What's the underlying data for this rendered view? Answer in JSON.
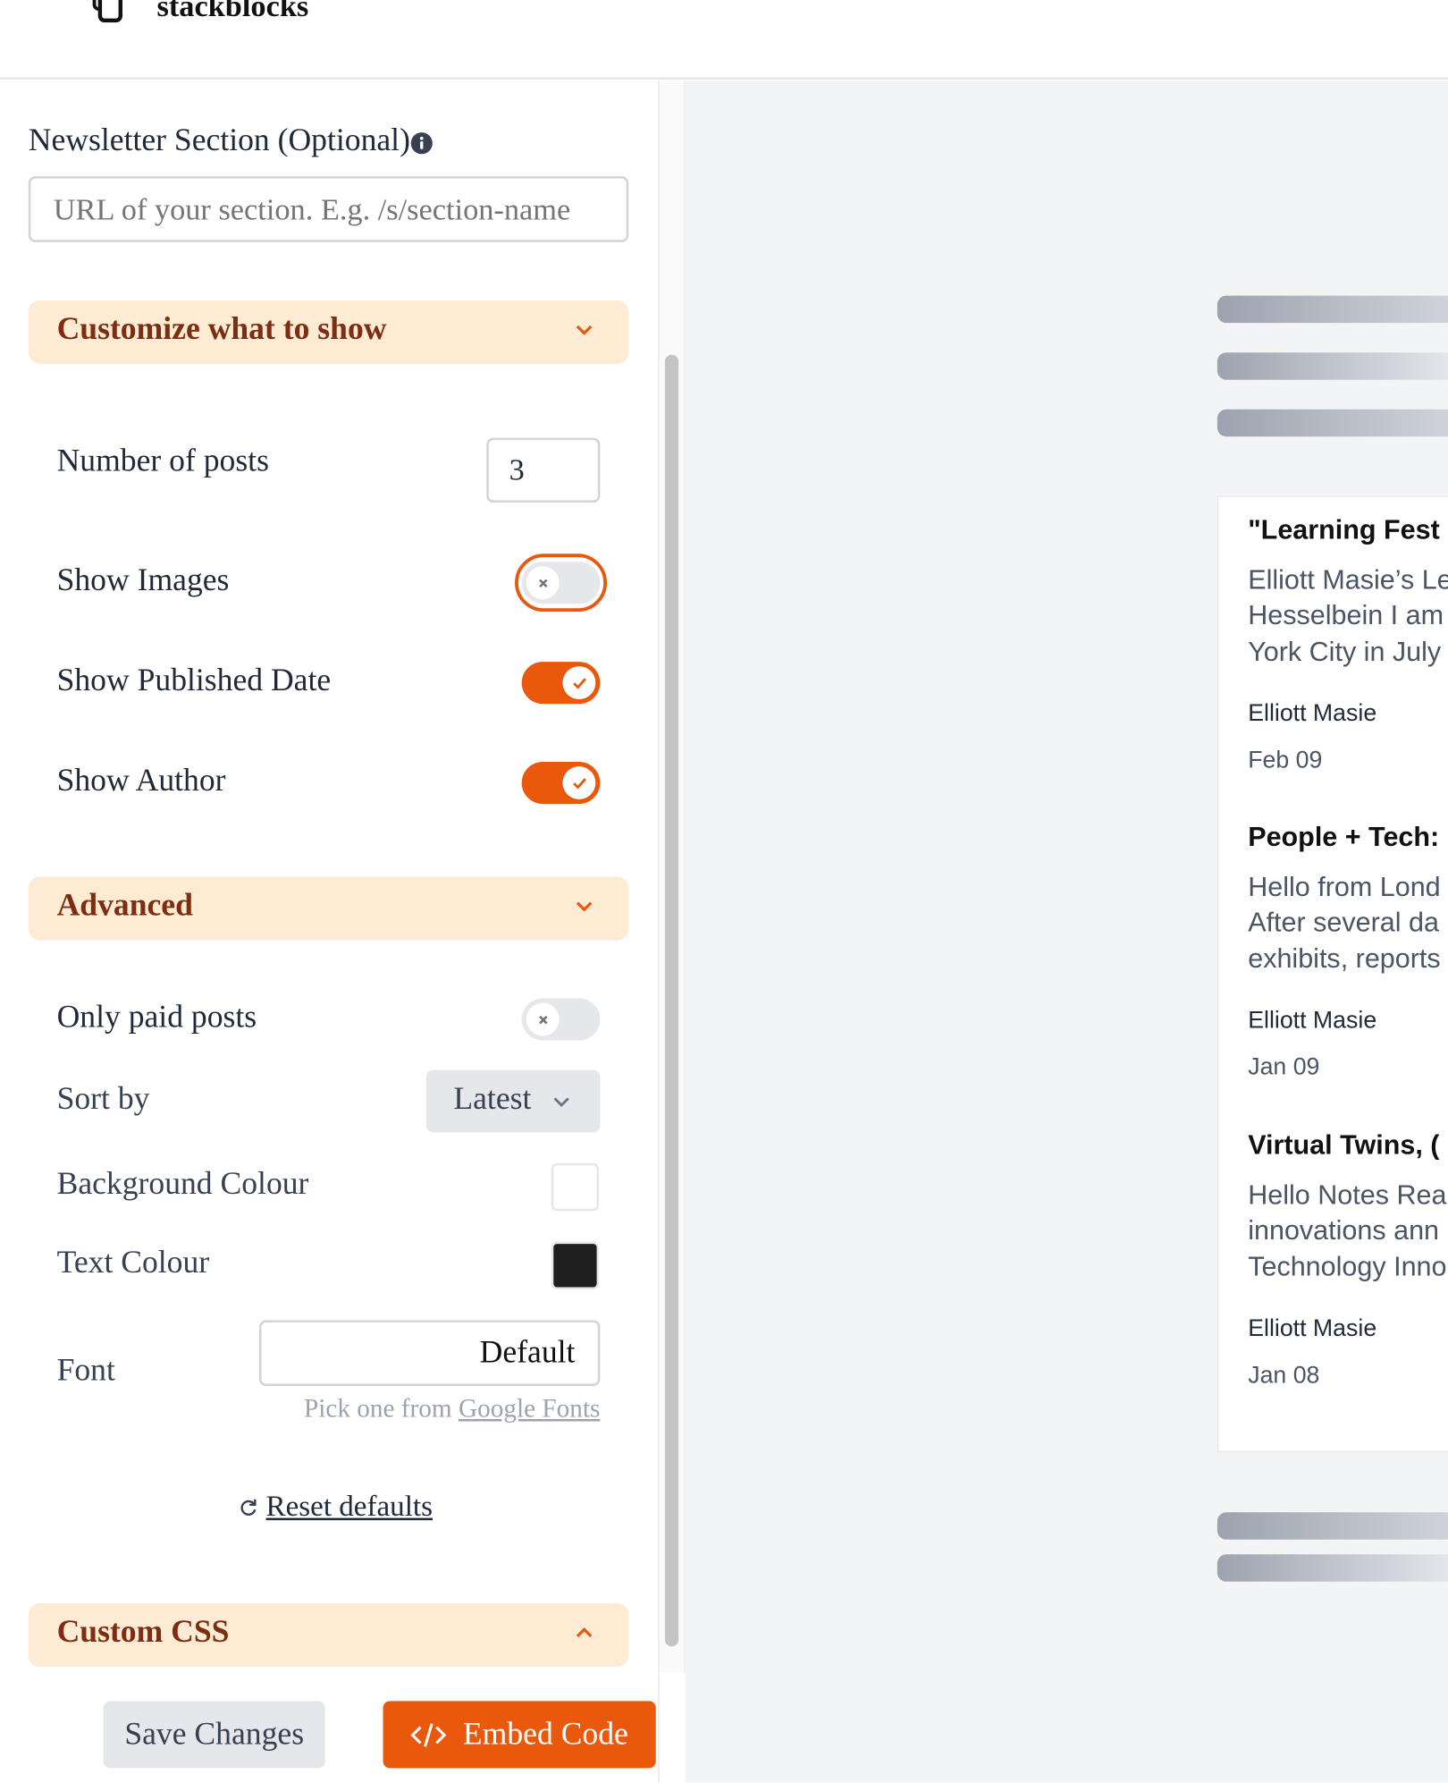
{
  "app": {
    "name": "stackblocks"
  },
  "section_field": {
    "label": "Newsletter Section (Optional)",
    "placeholder": "URL of your section. E.g. /s/section-name",
    "value": ""
  },
  "customize": {
    "title": "Customize what to show",
    "expanded": true,
    "number_of_posts": {
      "label": "Number of posts",
      "value": "3"
    },
    "show_images": {
      "label": "Show Images",
      "on": false
    },
    "show_published_date": {
      "label": "Show Published Date",
      "on": true
    },
    "show_author": {
      "label": "Show Author",
      "on": true
    }
  },
  "advanced": {
    "title": "Advanced",
    "expanded": true,
    "only_paid": {
      "label": "Only paid posts",
      "on": false
    },
    "sort_by": {
      "label": "Sort by",
      "value": "Latest"
    },
    "background_colour": {
      "label": "Background Colour",
      "value": "#ffffff"
    },
    "text_colour": {
      "label": "Text Colour",
      "value": "#1f1f1f"
    },
    "font": {
      "label": "Font",
      "value": "Default",
      "hint": "Pick one from",
      "hint_link": "Google Fonts"
    },
    "reset": "Reset defaults"
  },
  "custom_css": {
    "title": "Custom CSS",
    "expanded": false
  },
  "footer": {
    "save": "Save Changes",
    "embed": "Embed Code"
  },
  "colors": {
    "accent": "#ea580c",
    "section_bg": "#fdebd3",
    "section_text": "#7c2d12"
  },
  "preview": {
    "posts": [
      {
        "title": "\"Learning Fest",
        "excerpt": [
          "Elliott Masie’s Le",
          "Hesselbein I am",
          "York City in July"
        ],
        "author": "Elliott Masie",
        "date": "Feb 09"
      },
      {
        "title": "People + Tech:",
        "excerpt": [
          "Hello from Lond",
          "After several da",
          "exhibits, reports"
        ],
        "author": "Elliott Masie",
        "date": "Jan 09"
      },
      {
        "title": "Virtual Twins, (",
        "excerpt": [
          "Hello Notes Rea",
          "innovations ann",
          "Technology Inno"
        ],
        "author": "Elliott Masie",
        "date": "Jan 08"
      }
    ]
  }
}
